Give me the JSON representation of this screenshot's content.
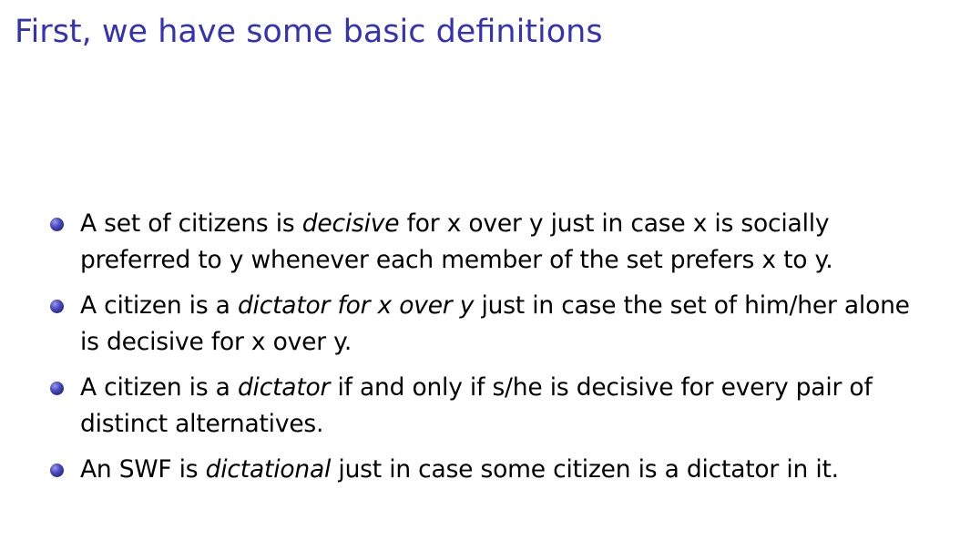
{
  "slide": {
    "title": "First, we have some basic definitions",
    "accent_color": "#3333b3",
    "bullet_icon": "circle-bullet-icon",
    "bullets": [
      {
        "line1": {
          "pre": "A set of citizens is ",
          "em": "decisive",
          "post": " for x over y just in case x is socially"
        },
        "line2": "preferred to y whenever each member of the set prefers x to y."
      },
      {
        "line1": {
          "pre": "A citizen is a ",
          "em": "dictator for x over y",
          "post": " just in case the set of him/her alone"
        },
        "line2": "is decisive for x over y."
      },
      {
        "line1": {
          "pre": "A citizen is a ",
          "em": "dictator",
          "post": " if and only if s/he is decisive for every pair of"
        },
        "line2": "distinct alternatives."
      },
      {
        "line1": {
          "pre": "An SWF is ",
          "em": "dictational",
          "post": " just in case some citizen is a dictator in it."
        }
      }
    ]
  }
}
